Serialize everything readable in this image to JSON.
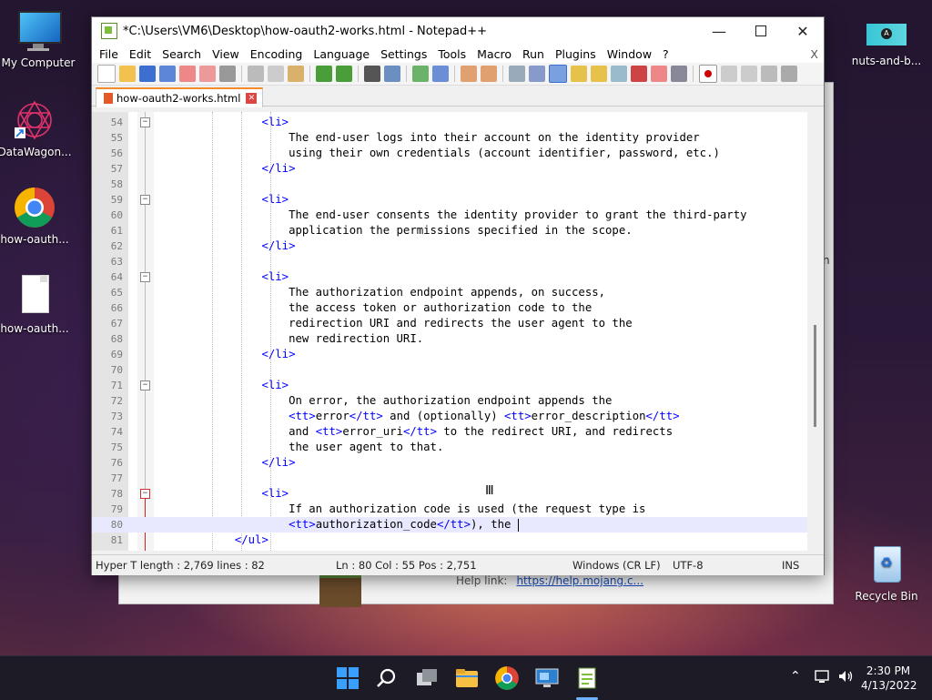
{
  "desktop": {
    "icons": [
      {
        "label": "My Computer"
      },
      {
        "label": "DataWagon..."
      },
      {
        "label": "how-oauth..."
      },
      {
        "label": "how-oauth..."
      },
      {
        "label": "nuts-and-b..."
      },
      {
        "label": "Recycle Bin"
      }
    ]
  },
  "background_window": {
    "help_label": "Help link:",
    "help_link": "https://help.mojang.c...",
    "edge_char": "n"
  },
  "window": {
    "title": "*C:\\Users\\VM6\\Desktop\\how-oauth2-works.html - Notepad++",
    "menu": [
      "File",
      "Edit",
      "Search",
      "View",
      "Encoding",
      "Language",
      "Settings",
      "Tools",
      "Macro",
      "Run",
      "Plugins",
      "Window",
      "?"
    ],
    "menu_close": "X",
    "tab": {
      "label": "how-oauth2-works.html"
    }
  },
  "editor": {
    "lines": [
      {
        "n": "54",
        "segs": [
          {
            "t": "                <li>",
            "tag": true
          }
        ]
      },
      {
        "n": "55",
        "segs": [
          {
            "t": "                    The end-user logs into their account on the identity provider"
          }
        ]
      },
      {
        "n": "56",
        "segs": [
          {
            "t": "                    using their own credentials (account identifier, password, etc.)"
          }
        ]
      },
      {
        "n": "57",
        "segs": [
          {
            "t": "                </li>",
            "tag": true
          }
        ]
      },
      {
        "n": "58",
        "segs": []
      },
      {
        "n": "59",
        "segs": [
          {
            "t": "                <li>",
            "tag": true
          }
        ]
      },
      {
        "n": "60",
        "segs": [
          {
            "t": "                    The end-user consents the identity provider to grant the third-party"
          }
        ]
      },
      {
        "n": "61",
        "segs": [
          {
            "t": "                    application the permissions specified in the scope."
          }
        ]
      },
      {
        "n": "62",
        "segs": [
          {
            "t": "                </li>",
            "tag": true
          }
        ]
      },
      {
        "n": "63",
        "segs": []
      },
      {
        "n": "64",
        "segs": [
          {
            "t": "                <li>",
            "tag": true
          }
        ]
      },
      {
        "n": "65",
        "segs": [
          {
            "t": "                    The authorization endpoint appends, on success,"
          }
        ]
      },
      {
        "n": "66",
        "segs": [
          {
            "t": "                    the access token or authorization code to the"
          }
        ]
      },
      {
        "n": "67",
        "segs": [
          {
            "t": "                    redirection URI and redirects the user agent to the"
          }
        ]
      },
      {
        "n": "68",
        "segs": [
          {
            "t": "                    new redirection URI."
          }
        ]
      },
      {
        "n": "69",
        "segs": [
          {
            "t": "                </li>",
            "tag": true
          }
        ]
      },
      {
        "n": "70",
        "segs": []
      },
      {
        "n": "71",
        "segs": [
          {
            "t": "                <li>",
            "tag": true
          }
        ]
      },
      {
        "n": "72",
        "segs": [
          {
            "t": "                    On error, the authorization endpoint appends the"
          }
        ]
      },
      {
        "n": "73",
        "segs": [
          {
            "t": "                    "
          },
          {
            "t": "<tt>",
            "tag": true
          },
          {
            "t": "error"
          },
          {
            "t": "</tt>",
            "tag": true
          },
          {
            "t": " and (optionally) "
          },
          {
            "t": "<tt>",
            "tag": true
          },
          {
            "t": "error_description"
          },
          {
            "t": "</tt>",
            "tag": true
          }
        ]
      },
      {
        "n": "74",
        "segs": [
          {
            "t": "                    and "
          },
          {
            "t": "<tt>",
            "tag": true
          },
          {
            "t": "error_uri"
          },
          {
            "t": "</tt>",
            "tag": true
          },
          {
            "t": " to the redirect URI, and redirects"
          }
        ]
      },
      {
        "n": "75",
        "segs": [
          {
            "t": "                    the user agent to that."
          }
        ]
      },
      {
        "n": "76",
        "segs": [
          {
            "t": "                </li>",
            "tag": true
          }
        ]
      },
      {
        "n": "77",
        "segs": []
      },
      {
        "n": "78",
        "segs": [
          {
            "t": "                <li>",
            "tag": true
          }
        ]
      },
      {
        "n": "79",
        "segs": [
          {
            "t": "                    If an authorization code is used (the request type is"
          }
        ]
      },
      {
        "n": "80",
        "segs": [
          {
            "t": "                    "
          },
          {
            "t": "<tt>",
            "tag": true
          },
          {
            "t": "authorization_code"
          },
          {
            "t": "</tt>",
            "tag": true
          },
          {
            "t": "), the "
          }
        ],
        "current": true
      },
      {
        "n": "81",
        "segs": [
          {
            "t": "            </ul>",
            "tag": true
          }
        ]
      }
    ]
  },
  "status": {
    "doc": "Hyper T length : 2,769    lines : 82",
    "pos": "Ln : 80    Col : 55    Pos : 2,751",
    "eol": "Windows (CR LF)",
    "enc": "UTF-8",
    "mode": "INS"
  },
  "taskbar": {
    "time": "2:30 PM",
    "date": "4/13/2022"
  }
}
